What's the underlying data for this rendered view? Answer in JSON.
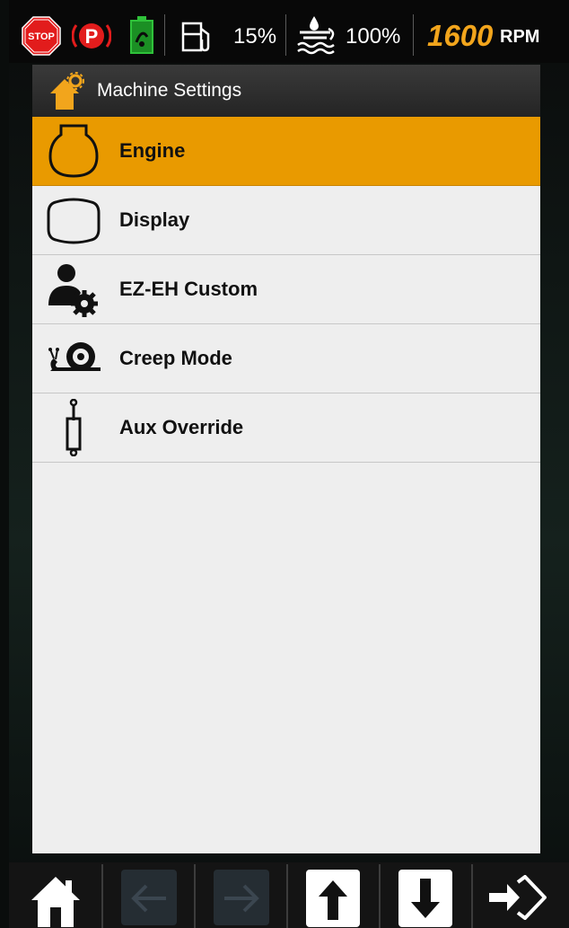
{
  "status_bar": {
    "stop_icon": {
      "text": "STOP",
      "color": "#e21c1c"
    },
    "park_icon": {
      "text": "P",
      "color": "#e21c1c"
    },
    "filter_icon": {
      "color": "#22a52b"
    },
    "fuel_level": "15%",
    "def_level": "100%",
    "rpm_value": "1600",
    "rpm_unit": "RPM",
    "rpm_color": "#f2a51c"
  },
  "panel": {
    "header_icon": "home-gear-icon",
    "title": "Machine Settings",
    "accent": "#e99a00",
    "items": [
      {
        "label": "Engine",
        "icon": "engine-icon",
        "selected": true
      },
      {
        "label": "Display",
        "icon": "display-icon",
        "selected": false
      },
      {
        "label": "EZ-EH Custom",
        "icon": "user-gear-icon",
        "selected": false
      },
      {
        "label": "Creep Mode",
        "icon": "snail-icon",
        "selected": false
      },
      {
        "label": "Aux Override",
        "icon": "cylinder-icon",
        "selected": false
      }
    ]
  },
  "bottom_bar": {
    "buttons": [
      {
        "icon": "home-icon",
        "enabled": true
      },
      {
        "icon": "arrow-left-icon",
        "enabled": false
      },
      {
        "icon": "arrow-right-icon",
        "enabled": false
      },
      {
        "icon": "arrow-up-icon",
        "enabled": true
      },
      {
        "icon": "arrow-down-icon",
        "enabled": true
      },
      {
        "icon": "exit-icon",
        "enabled": true
      }
    ]
  }
}
